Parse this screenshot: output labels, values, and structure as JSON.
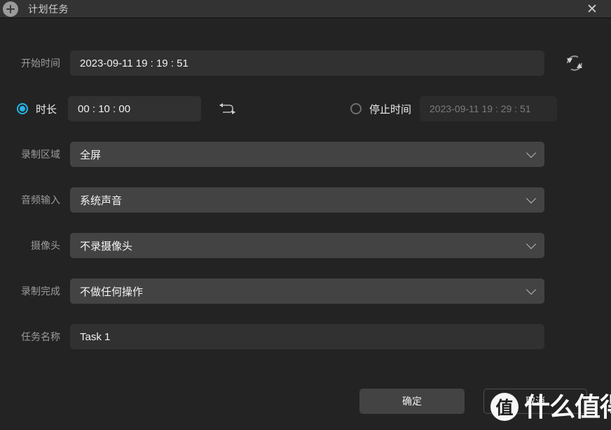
{
  "titlebar": {
    "title": "计划任务",
    "add_icon": "plus-circle-icon",
    "close_label": "✕"
  },
  "form": {
    "start_time": {
      "label": "开始时间",
      "value": "2023-09-11 19 : 19 : 51"
    },
    "refresh": {
      "icon": "refresh-icon"
    },
    "duration": {
      "radio_label": "时长",
      "value": "00 : 10 : 00",
      "selected": true,
      "loop_icon": "loop-icon"
    },
    "stop_time": {
      "radio_label": "停止时间",
      "value": "2023-09-11 19 : 29 : 51",
      "selected": false
    },
    "record_area": {
      "label": "录制区域",
      "value": "全屏"
    },
    "audio_input": {
      "label": "音频输入",
      "value": "系统声音"
    },
    "camera": {
      "label": "摄像头",
      "value": "不录摄像头"
    },
    "after_record": {
      "label": "录制完成",
      "value": "不做任何操作"
    },
    "task_name": {
      "label": "任务名称",
      "value": "Task 1"
    }
  },
  "footer": {
    "ok_label": "确定",
    "cancel_label": "取消"
  },
  "watermark": {
    "badge": "值",
    "text": "什么值得买"
  },
  "colors": {
    "accent": "#27b4e4",
    "background": "#232323",
    "titlebar": "#333333",
    "input": "#313131",
    "select": "#434343"
  }
}
